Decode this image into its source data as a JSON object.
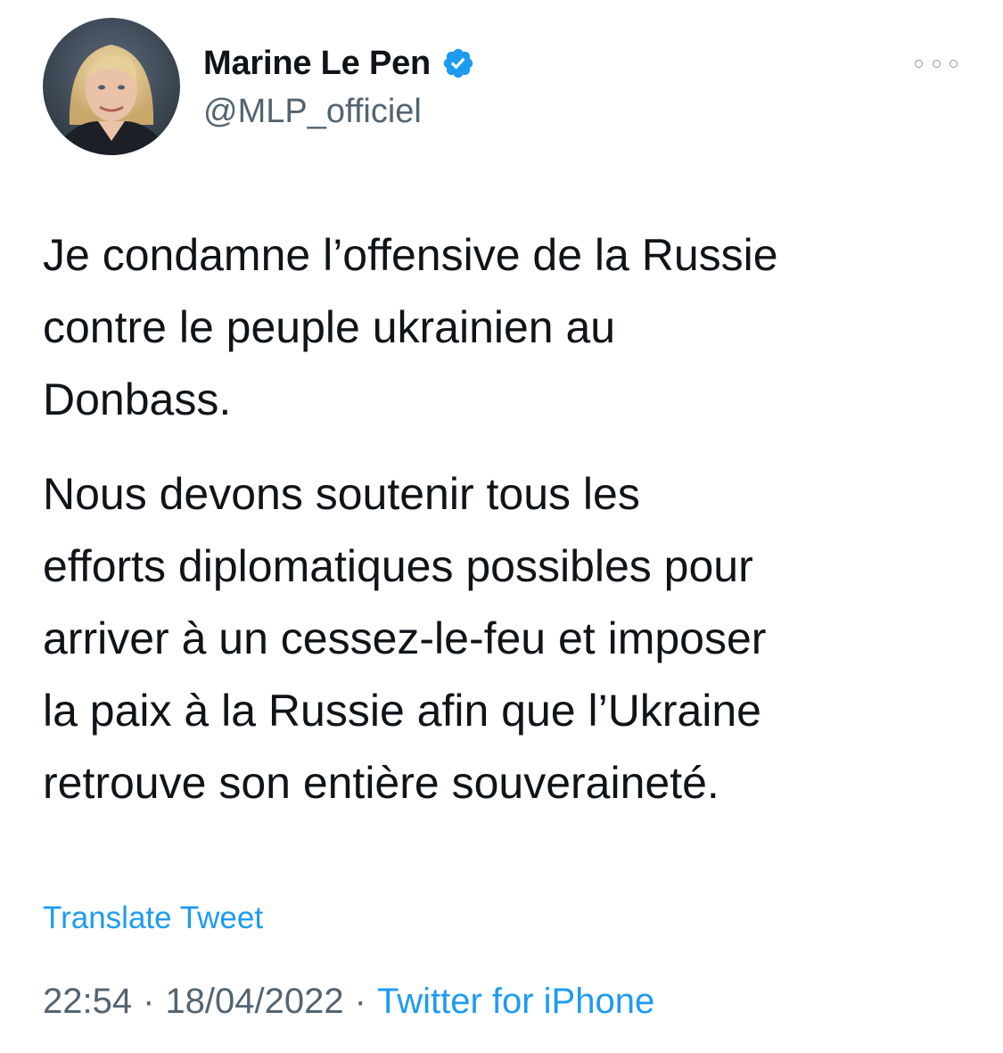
{
  "author": {
    "display_name": "Marine Le Pen",
    "handle": "@MLP_officiel",
    "verified": true
  },
  "tweet": {
    "paragraphs": [
      "Je condamne l’offensive de la Russie\ncontre le peuple ukrainien au\nDonbass.",
      "Nous devons soutenir tous les\nefforts diplomatiques possibles pour\narriver à un cessez-le-feu et imposer\nla paix à la Russie afin que l’Ukraine\nretrouve son entière souveraineté."
    ],
    "translate_label": "Translate Tweet",
    "time": "22:54",
    "date": "18/04/2022",
    "separator": "·",
    "source": "Twitter for iPhone"
  },
  "icons": {
    "verified": "verified-badge-icon",
    "more": "more-options-icon"
  },
  "colors": {
    "link": "#1d9bf0",
    "secondary_text": "#536471",
    "primary_text": "#0f1419",
    "verified_badge": "#1d9bf0"
  }
}
